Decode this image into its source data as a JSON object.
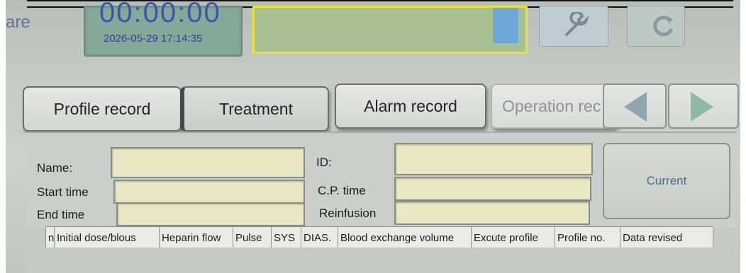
{
  "header": {
    "corner_label": "are",
    "clock": "00:00:00",
    "datetime": "2026-05-29 17:14:35"
  },
  "icons": {
    "tool_button": "wrench-icon",
    "refresh_button": "refresh-icon"
  },
  "tabs": [
    {
      "label": "Profile record"
    },
    {
      "label": "Treatment"
    },
    {
      "label": "Alarm record"
    },
    {
      "label": "Operation rec"
    }
  ],
  "nav": {
    "prev": "arrow-left-icon",
    "next": "arrow-right-icon"
  },
  "form": {
    "name_label": "Name:",
    "start_label": "Start time",
    "end_label": "End time",
    "id_label": "ID:",
    "cp_label": "C.P. time",
    "reinfusion_label": "Reinfusion",
    "name_value": "",
    "start_value": "",
    "end_value": "",
    "id_value": "",
    "cp_value": "",
    "reinfusion_value": "",
    "current_button": "Current"
  },
  "table": {
    "columns": [
      "n",
      "Initial dose/blous",
      "Heparin flow",
      "Pulse",
      "SYS",
      "DIAS.",
      "Blood exchange volume",
      "Excute profile",
      "Profile no.",
      "Data revised"
    ]
  },
  "colors": {
    "tab_text": "#22262a",
    "field_bg": "#e9e8c4",
    "clock_panel": "#86a89b",
    "status_border": "#e5e03a",
    "current_text": "#4b6f86"
  }
}
